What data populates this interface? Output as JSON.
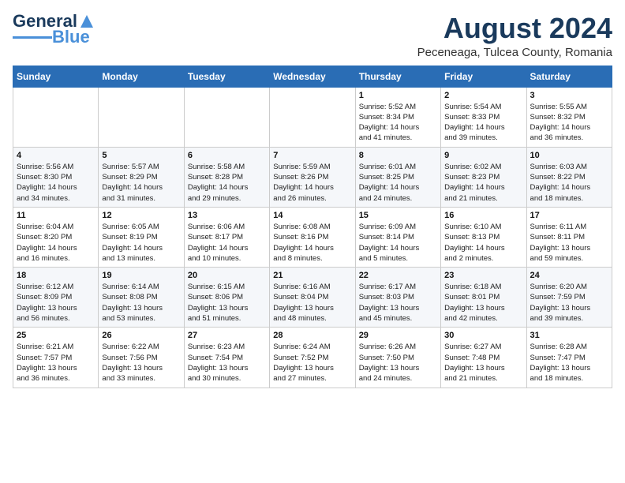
{
  "header": {
    "logo_general": "General",
    "logo_blue": "Blue",
    "month": "August 2024",
    "location": "Peceneaga, Tulcea County, Romania"
  },
  "days_of_week": [
    "Sunday",
    "Monday",
    "Tuesday",
    "Wednesday",
    "Thursday",
    "Friday",
    "Saturday"
  ],
  "weeks": [
    [
      {
        "day": "",
        "info": ""
      },
      {
        "day": "",
        "info": ""
      },
      {
        "day": "",
        "info": ""
      },
      {
        "day": "",
        "info": ""
      },
      {
        "day": "1",
        "info": "Sunrise: 5:52 AM\nSunset: 8:34 PM\nDaylight: 14 hours\nand 41 minutes."
      },
      {
        "day": "2",
        "info": "Sunrise: 5:54 AM\nSunset: 8:33 PM\nDaylight: 14 hours\nand 39 minutes."
      },
      {
        "day": "3",
        "info": "Sunrise: 5:55 AM\nSunset: 8:32 PM\nDaylight: 14 hours\nand 36 minutes."
      }
    ],
    [
      {
        "day": "4",
        "info": "Sunrise: 5:56 AM\nSunset: 8:30 PM\nDaylight: 14 hours\nand 34 minutes."
      },
      {
        "day": "5",
        "info": "Sunrise: 5:57 AM\nSunset: 8:29 PM\nDaylight: 14 hours\nand 31 minutes."
      },
      {
        "day": "6",
        "info": "Sunrise: 5:58 AM\nSunset: 8:28 PM\nDaylight: 14 hours\nand 29 minutes."
      },
      {
        "day": "7",
        "info": "Sunrise: 5:59 AM\nSunset: 8:26 PM\nDaylight: 14 hours\nand 26 minutes."
      },
      {
        "day": "8",
        "info": "Sunrise: 6:01 AM\nSunset: 8:25 PM\nDaylight: 14 hours\nand 24 minutes."
      },
      {
        "day": "9",
        "info": "Sunrise: 6:02 AM\nSunset: 8:23 PM\nDaylight: 14 hours\nand 21 minutes."
      },
      {
        "day": "10",
        "info": "Sunrise: 6:03 AM\nSunset: 8:22 PM\nDaylight: 14 hours\nand 18 minutes."
      }
    ],
    [
      {
        "day": "11",
        "info": "Sunrise: 6:04 AM\nSunset: 8:20 PM\nDaylight: 14 hours\nand 16 minutes."
      },
      {
        "day": "12",
        "info": "Sunrise: 6:05 AM\nSunset: 8:19 PM\nDaylight: 14 hours\nand 13 minutes."
      },
      {
        "day": "13",
        "info": "Sunrise: 6:06 AM\nSunset: 8:17 PM\nDaylight: 14 hours\nand 10 minutes."
      },
      {
        "day": "14",
        "info": "Sunrise: 6:08 AM\nSunset: 8:16 PM\nDaylight: 14 hours\nand 8 minutes."
      },
      {
        "day": "15",
        "info": "Sunrise: 6:09 AM\nSunset: 8:14 PM\nDaylight: 14 hours\nand 5 minutes."
      },
      {
        "day": "16",
        "info": "Sunrise: 6:10 AM\nSunset: 8:13 PM\nDaylight: 14 hours\nand 2 minutes."
      },
      {
        "day": "17",
        "info": "Sunrise: 6:11 AM\nSunset: 8:11 PM\nDaylight: 13 hours\nand 59 minutes."
      }
    ],
    [
      {
        "day": "18",
        "info": "Sunrise: 6:12 AM\nSunset: 8:09 PM\nDaylight: 13 hours\nand 56 minutes."
      },
      {
        "day": "19",
        "info": "Sunrise: 6:14 AM\nSunset: 8:08 PM\nDaylight: 13 hours\nand 53 minutes."
      },
      {
        "day": "20",
        "info": "Sunrise: 6:15 AM\nSunset: 8:06 PM\nDaylight: 13 hours\nand 51 minutes."
      },
      {
        "day": "21",
        "info": "Sunrise: 6:16 AM\nSunset: 8:04 PM\nDaylight: 13 hours\nand 48 minutes."
      },
      {
        "day": "22",
        "info": "Sunrise: 6:17 AM\nSunset: 8:03 PM\nDaylight: 13 hours\nand 45 minutes."
      },
      {
        "day": "23",
        "info": "Sunrise: 6:18 AM\nSunset: 8:01 PM\nDaylight: 13 hours\nand 42 minutes."
      },
      {
        "day": "24",
        "info": "Sunrise: 6:20 AM\nSunset: 7:59 PM\nDaylight: 13 hours\nand 39 minutes."
      }
    ],
    [
      {
        "day": "25",
        "info": "Sunrise: 6:21 AM\nSunset: 7:57 PM\nDaylight: 13 hours\nand 36 minutes."
      },
      {
        "day": "26",
        "info": "Sunrise: 6:22 AM\nSunset: 7:56 PM\nDaylight: 13 hours\nand 33 minutes."
      },
      {
        "day": "27",
        "info": "Sunrise: 6:23 AM\nSunset: 7:54 PM\nDaylight: 13 hours\nand 30 minutes."
      },
      {
        "day": "28",
        "info": "Sunrise: 6:24 AM\nSunset: 7:52 PM\nDaylight: 13 hours\nand 27 minutes."
      },
      {
        "day": "29",
        "info": "Sunrise: 6:26 AM\nSunset: 7:50 PM\nDaylight: 13 hours\nand 24 minutes."
      },
      {
        "day": "30",
        "info": "Sunrise: 6:27 AM\nSunset: 7:48 PM\nDaylight: 13 hours\nand 21 minutes."
      },
      {
        "day": "31",
        "info": "Sunrise: 6:28 AM\nSunset: 7:47 PM\nDaylight: 13 hours\nand 18 minutes."
      }
    ]
  ]
}
